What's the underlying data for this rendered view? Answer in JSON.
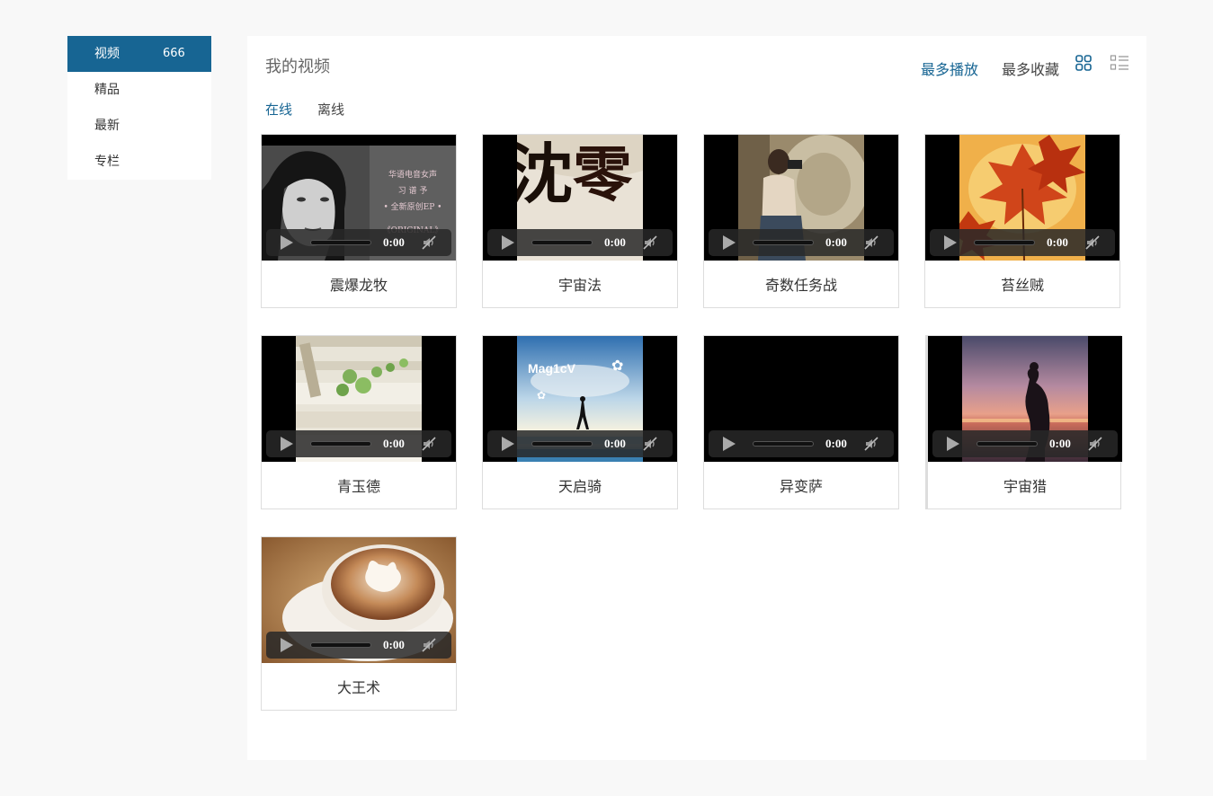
{
  "sidebar": {
    "items": [
      {
        "label": "视频",
        "count": "666"
      },
      {
        "label": "精品"
      },
      {
        "label": "最新"
      },
      {
        "label": "专栏"
      }
    ]
  },
  "header": {
    "title": "我的视频",
    "sort_most_played": "最多播放",
    "sort_most_favorited": "最多收藏"
  },
  "tabs": {
    "online": "在线",
    "offline": "离线"
  },
  "videos": [
    {
      "title": "震爆龙牧",
      "time": "0:00",
      "poster_text": [
        "华语电音女声",
        "习 谱 予",
        "• 全新原创EP •",
        "《ORIGINAL》"
      ]
    },
    {
      "title": "宇宙法",
      "time": "0:00",
      "poster_text": [
        "沈",
        "零"
      ]
    },
    {
      "title": "奇数任务战",
      "time": "0:00"
    },
    {
      "title": "苔丝贼",
      "time": "0:00"
    },
    {
      "title": "青玉德",
      "time": "0:00"
    },
    {
      "title": "天启骑",
      "time": "0:00",
      "poster_text": [
        "Mag1cV"
      ]
    },
    {
      "title": "异变萨",
      "time": "0:00"
    },
    {
      "title": "宇宙猎",
      "time": "0:00"
    },
    {
      "title": "大王术",
      "time": "0:00"
    }
  ],
  "colors": {
    "accent": "#176593",
    "page_bg": "#f8f8f8"
  }
}
